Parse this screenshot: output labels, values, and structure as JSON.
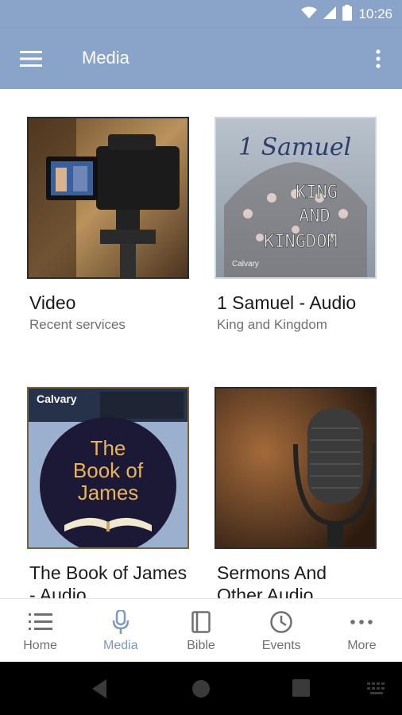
{
  "status_bar": {
    "time": "10:26"
  },
  "app_bar": {
    "title": "Media"
  },
  "cards": [
    {
      "title": "Video",
      "subtitle": "Recent services"
    },
    {
      "title": "1 Samuel - Audio",
      "subtitle": "King and Kingdom",
      "art_line1": "1 Samuel",
      "art_line2": "KING",
      "art_line3": "AND",
      "art_line4": "KINGDOM",
      "art_brand": "Calvary"
    },
    {
      "title": "The Book of James - Audio",
      "subtitle": "",
      "art_line1": "The",
      "art_line2": "Book of",
      "art_line3": "James",
      "art_brand": "Calvary"
    },
    {
      "title": "Sermons And Other Audio",
      "subtitle": ""
    }
  ],
  "bottom_nav": {
    "items": [
      {
        "label": "Home",
        "icon": "list-icon"
      },
      {
        "label": "Media",
        "icon": "microphone-icon",
        "active": true
      },
      {
        "label": "Bible",
        "icon": "book-icon"
      },
      {
        "label": "Events",
        "icon": "clock-icon"
      },
      {
        "label": "More",
        "icon": "more-horizontal-icon"
      }
    ]
  },
  "colors": {
    "primary": "#8aa3c9",
    "accent": "#7d97c2",
    "text": "#1a1a1a",
    "muted": "#707070"
  }
}
